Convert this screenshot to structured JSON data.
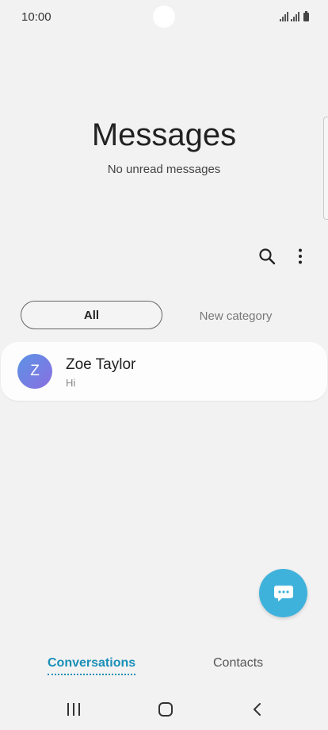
{
  "status_bar": {
    "time": "10:00"
  },
  "header": {
    "title": "Messages",
    "subtitle": "No unread messages"
  },
  "toolbar": {
    "search_icon": "search-icon",
    "more_icon": "more-vertical-icon"
  },
  "categories": {
    "all_label": "All",
    "new_label": "New category"
  },
  "conversations": [
    {
      "avatar_letter": "Z",
      "name": "Zoe Taylor",
      "preview": "Hi"
    }
  ],
  "fab": {
    "icon": "compose-message-icon",
    "color": "#3fb2dc"
  },
  "bottom_tabs": {
    "conversations": "Conversations",
    "contacts": "Contacts",
    "active_color": "#1a8fb8"
  },
  "nav_bar": {
    "recents_icon": "recents-icon",
    "home_icon": "home-icon",
    "back_icon": "back-icon"
  }
}
